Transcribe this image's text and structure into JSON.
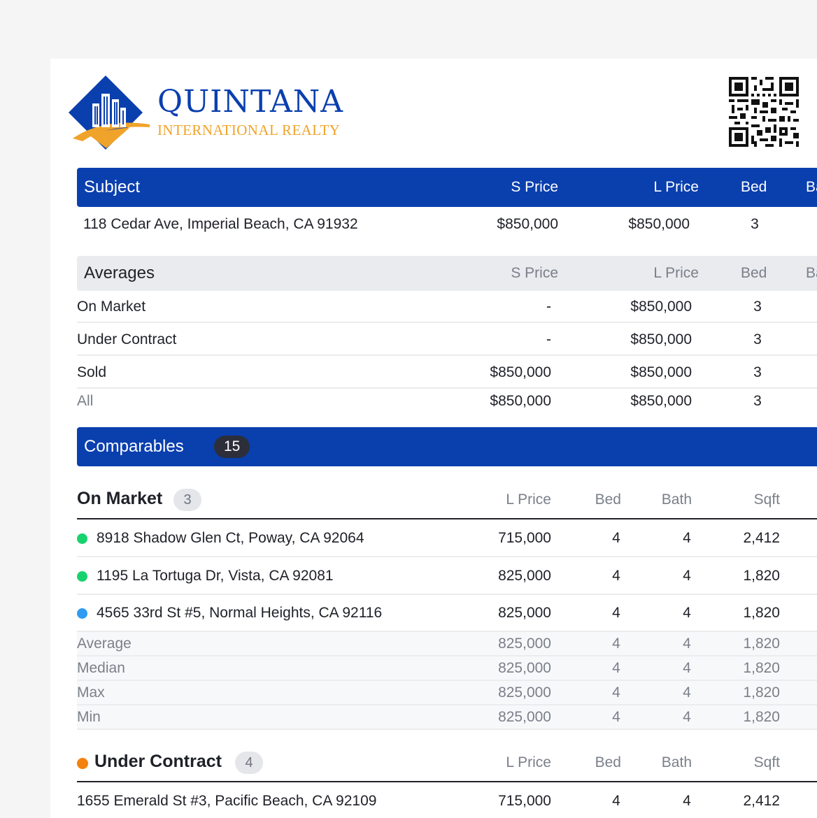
{
  "brand": {
    "name": "QUINTANA",
    "sub": "INTERNATIONAL REALTY",
    "colors": {
      "primary": "#0a3fae",
      "accent": "#f0a32a"
    }
  },
  "subject": {
    "header": {
      "title": "Subject",
      "s_price": "S Price",
      "l_price": "L Price",
      "bed": "Bed",
      "bath_cut": "Ba"
    },
    "row": {
      "address": "118 Cedar Ave, Imperial Beach, CA 91932",
      "s_price": "$850,000",
      "l_price": "$850,000",
      "bed": "3"
    }
  },
  "averages": {
    "header": {
      "title": "Averages",
      "s_price": "S Price",
      "l_price": "L Price",
      "bed": "Bed",
      "bath_cut": "Ba"
    },
    "rows": [
      {
        "label": "On Market",
        "s_price": "-",
        "l_price": "$850,000",
        "bed": "3"
      },
      {
        "label": "Under Contract",
        "s_price": "-",
        "l_price": "$850,000",
        "bed": "3"
      },
      {
        "label": "Sold",
        "s_price": "$850,000",
        "l_price": "$850,000",
        "bed": "3"
      },
      {
        "label": "All",
        "s_price": "$850,000",
        "l_price": "$850,000",
        "bed": "3"
      }
    ]
  },
  "comparables": {
    "title": "Comparables",
    "count": "15"
  },
  "on_market": {
    "title": "On Market",
    "count": "3",
    "columns": {
      "l_price": "L Price",
      "bed": "Bed",
      "bath": "Bath",
      "sqft": "Sqft"
    },
    "rows": [
      {
        "address": "8918 Shadow Glen Ct, Poway, CA 92064",
        "l_price": "715,000",
        "bed": "4",
        "bath": "4",
        "sqft": "2,412",
        "status_color": "#18d26e"
      },
      {
        "address": "1195 La Tortuga Dr, Vista, CA 92081",
        "l_price": "825,000",
        "bed": "4",
        "bath": "4",
        "sqft": "1,820",
        "status_color": "#18d26e"
      },
      {
        "address": "4565 33rd St #5, Normal Heights, CA 92116",
        "l_price": "825,000",
        "bed": "4",
        "bath": "4",
        "sqft": "1,820",
        "status_color": "#2f9bf2"
      }
    ],
    "stats": [
      {
        "label": "Average",
        "l_price": "825,000",
        "bed": "4",
        "bath": "4",
        "sqft": "1,820"
      },
      {
        "label": "Median",
        "l_price": "825,000",
        "bed": "4",
        "bath": "4",
        "sqft": "1,820"
      },
      {
        "label": "Max",
        "l_price": "825,000",
        "bed": "4",
        "bath": "4",
        "sqft": "1,820"
      },
      {
        "label": "Min",
        "l_price": "825,000",
        "bed": "4",
        "bath": "4",
        "sqft": "1,820"
      }
    ]
  },
  "under_contract": {
    "title": "Under Contract",
    "count": "4",
    "status_color": "#f4820f",
    "columns": {
      "l_price": "L Price",
      "bed": "Bed",
      "bath": "Bath",
      "sqft": "Sqft"
    },
    "rows": [
      {
        "address": "1655 Emerald St #3, Pacific Beach, CA 92109",
        "l_price": "715,000",
        "bed": "4",
        "bath": "4",
        "sqft": "2,412"
      }
    ]
  }
}
